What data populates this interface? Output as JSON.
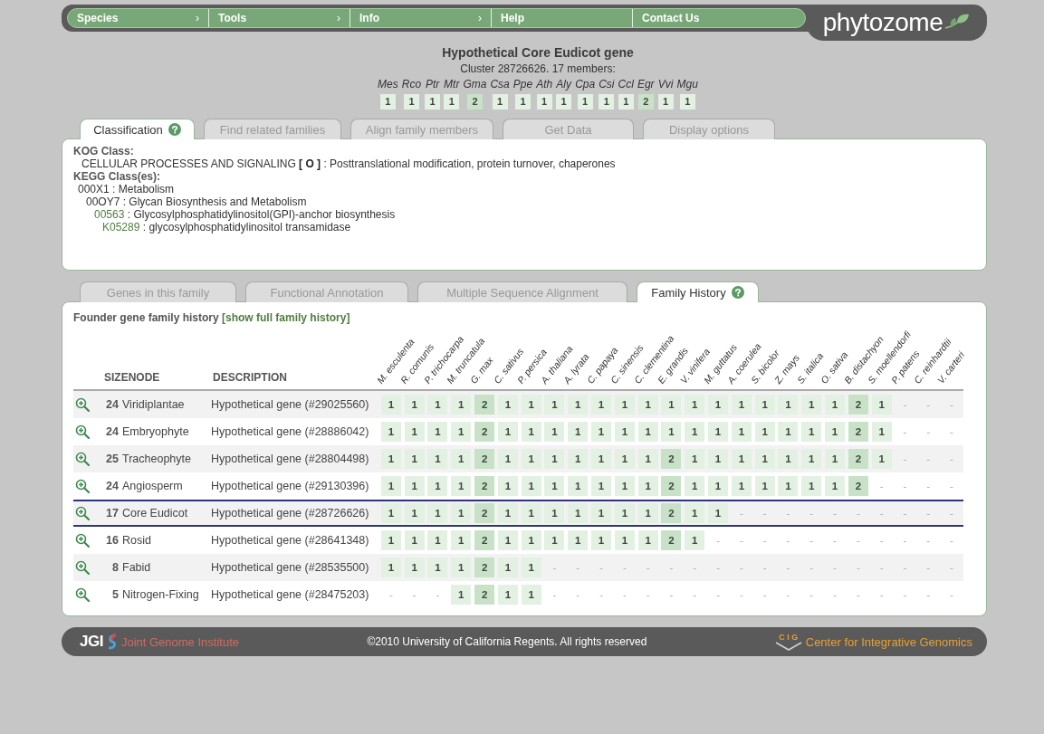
{
  "nav": {
    "items": [
      {
        "label": "Species",
        "chevron": "›"
      },
      {
        "label": "Tools",
        "chevron": "›"
      },
      {
        "label": "Info",
        "chevron": "›"
      },
      {
        "label": "Help"
      },
      {
        "label": "Contact Us"
      }
    ],
    "logo": "phytozome"
  },
  "header": {
    "title": "Hypothetical Core Eudicot gene",
    "subtitle": "Cluster 28726626. 17 members:",
    "members": [
      {
        "abbr": "Mes",
        "count": "1",
        "kind": "low"
      },
      {
        "abbr": "Rco",
        "count": "1",
        "kind": "low"
      },
      {
        "abbr": "Ptr",
        "count": "1",
        "kind": "low"
      },
      {
        "abbr": "Mtr",
        "count": "1",
        "kind": "low"
      },
      {
        "abbr": "Gma",
        "count": "2",
        "kind": "high"
      },
      {
        "abbr": "Csa",
        "count": "1",
        "kind": "low"
      },
      {
        "abbr": "Ppe",
        "count": "1",
        "kind": "low"
      },
      {
        "abbr": "Ath",
        "count": "1",
        "kind": "low"
      },
      {
        "abbr": "Aly",
        "count": "1",
        "kind": "low"
      },
      {
        "abbr": "Cpa",
        "count": "1",
        "kind": "low"
      },
      {
        "abbr": "Csi",
        "count": "1",
        "kind": "low"
      },
      {
        "abbr": "Ccl",
        "count": "1",
        "kind": "low"
      },
      {
        "abbr": "Egr",
        "count": "2",
        "kind": "high"
      },
      {
        "abbr": "Vvi",
        "count": "1",
        "kind": "low"
      },
      {
        "abbr": "Mgu",
        "count": "1",
        "kind": "low"
      }
    ]
  },
  "top_tabs": [
    {
      "label": "Classification",
      "selected": true,
      "help": true
    },
    {
      "label": "Find related families",
      "selected": false,
      "help": false
    },
    {
      "label": "Align family members",
      "selected": false,
      "help": false
    },
    {
      "label": "Get Data",
      "selected": false,
      "help": false
    },
    {
      "label": "Display options",
      "selected": false,
      "help": false
    }
  ],
  "classification": {
    "kog_heading": "KOG Class:",
    "kog_text": "CELLULAR PROCESSES AND SIGNALING **[ O ]** : Posttranslational modification, protein turnover, chaperones",
    "kegg_heading": "KEGG Class(es):",
    "kegg_tree": [
      {
        "code": "000X1",
        "label": " : Metabolism",
        "link": false,
        "children": [
          {
            "code": "00OY7",
            "label": " : Glycan Biosynthesis and Metabolism",
            "link": false,
            "children": [
              {
                "code": "00563",
                "label": " : Glycosylphosphatidylinositol(GPI)-anchor biosynthesis",
                "link": true,
                "children": [
                  {
                    "code": "K05289",
                    "label": " : glycosylphosphatidylinositol transamidase",
                    "link": true
                  }
                ]
              }
            ]
          }
        ]
      }
    ]
  },
  "bottom_tabs": [
    {
      "label": "Genes in this family",
      "selected": false,
      "help": false
    },
    {
      "label": "Functional Annotation",
      "selected": false,
      "help": false
    },
    {
      "label": "Multiple Sequence Alignment",
      "selected": false,
      "help": false
    },
    {
      "label": "Family History",
      "selected": true,
      "help": true
    }
  ],
  "history": {
    "title": "Founder gene family history",
    "link": "[show full family history]",
    "columns": {
      "sizenode": "SIZENODE",
      "description": "DESCRIPTION"
    },
    "species": [
      "M. esculenta",
      "R. comunis",
      "P. trichocarpa",
      "M. truncatula",
      "G. max",
      "C. sativus",
      "P. persica",
      "A. thaliana",
      "A. lyrata",
      "C. papaya",
      "C. sinensis",
      "C. clementina",
      "E. grandis",
      "V. vinifera",
      "M. guttatus",
      "A. coerulea",
      "S. bicolor",
      "Z. mays",
      "S. italica",
      "O. sativa",
      "B. distachyon",
      "S. moellendorfi",
      "P. patens",
      "C. reinhardtii",
      "V. carteri"
    ],
    "rows": [
      {
        "size": "24",
        "node": "Viridiplantae",
        "description": "Hypothetical gene (#29025560)",
        "selected": false,
        "counts": "1 1 1 1 2 1 1 1 1 1 1 1 1 1 1 1 1 1 1 1 2 1 - - -"
      },
      {
        "size": "24",
        "node": "Embryophyte",
        "description": "Hypothetical gene (#28886042)",
        "selected": false,
        "counts": "1 1 1 1 2 1 1 1 1 1 1 1 1 1 1 1 1 1 1 1 2 1 - - -"
      },
      {
        "size": "25",
        "node": "Tracheophyte",
        "description": "Hypothetical gene (#28804498)",
        "selected": false,
        "counts": "1 1 1 1 2 1 1 1 1 1 1 1 2 1 1 1 1 1 1 1 2 1 - - -"
      },
      {
        "size": "24",
        "node": "Angiosperm",
        "description": "Hypothetical gene (#29130396)",
        "selected": false,
        "counts": "1 1 1 1 2 1 1 1 1 1 1 1 2 1 1 1 1 1 1 1 2 - - - -"
      },
      {
        "size": "17",
        "node": "Core Eudicot",
        "description": "Hypothetical gene (#28726626)",
        "selected": true,
        "counts": "1 1 1 1 2 1 1 1 1 1 1 1 2 1 1 - - - - - - - - - -"
      },
      {
        "size": "16",
        "node": "Rosid",
        "description": "Hypothetical gene (#28641348)",
        "selected": false,
        "counts": "1 1 1 1 2 1 1 1 1 1 1 1 2 1 - - - - - - - - - - -"
      },
      {
        "size": "8",
        "node": "Fabid",
        "description": "Hypothetical gene (#28535500)",
        "selected": false,
        "counts": "1 1 1 1 2 1 1 - - - - - - - - - - - - - - - - - -"
      },
      {
        "size": "5",
        "node": "Nitrogen-Fixing",
        "description": "Hypothetical gene (#28475203)",
        "selected": false,
        "counts": "- - - 1 2 1 1 - - - - - - - - - - - - - - - - - -"
      }
    ]
  },
  "footer": {
    "jgi": "JGI",
    "jgi_name": "Joint Genome Institute",
    "copyright": "©2010 University of California Regents. All rights reserved",
    "cig": "C I G",
    "cig_name": "Center for Integrative Genomics"
  }
}
